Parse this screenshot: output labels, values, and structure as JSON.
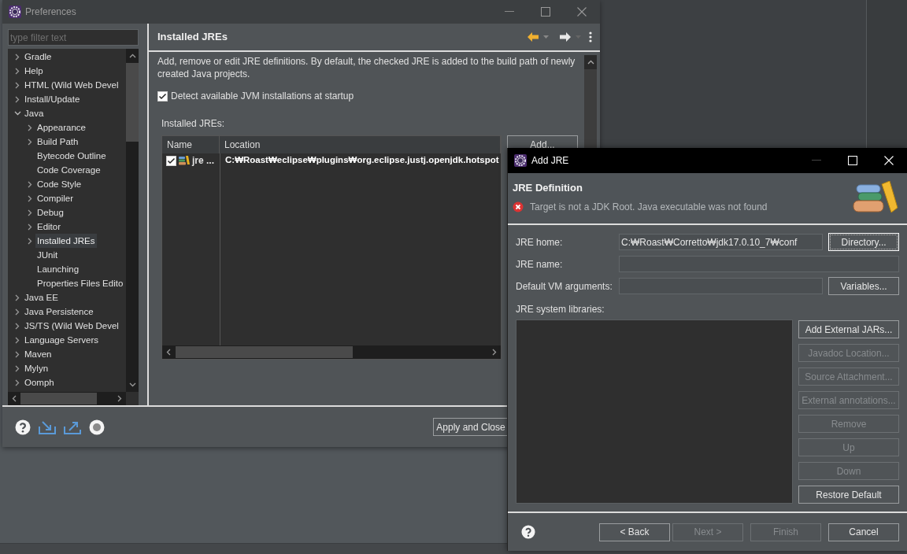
{
  "preferences": {
    "title": "Preferences",
    "filter": {
      "placeholder": "type filter text"
    },
    "tree": [
      {
        "label": "Gradle",
        "expandable": true,
        "expanded": false,
        "selected": false
      },
      {
        "label": "Help",
        "expandable": true,
        "expanded": false,
        "selected": false
      },
      {
        "label": "HTML (Wild Web Devel",
        "expandable": true,
        "expanded": false,
        "selected": false
      },
      {
        "label": "Install/Update",
        "expandable": true,
        "expanded": false,
        "selected": false
      },
      {
        "label": "Java",
        "expandable": true,
        "expanded": true,
        "selected": false,
        "children": [
          {
            "label": "Appearance",
            "expandable": true,
            "expanded": false,
            "selected": false
          },
          {
            "label": "Build Path",
            "expandable": true,
            "expanded": false,
            "selected": false
          },
          {
            "label": "Bytecode Outline",
            "expandable": false,
            "expanded": false,
            "selected": false
          },
          {
            "label": "Code Coverage",
            "expandable": false,
            "expanded": false,
            "selected": false
          },
          {
            "label": "Code Style",
            "expandable": true,
            "expanded": false,
            "selected": false
          },
          {
            "label": "Compiler",
            "expandable": true,
            "expanded": false,
            "selected": false
          },
          {
            "label": "Debug",
            "expandable": true,
            "expanded": false,
            "selected": false
          },
          {
            "label": "Editor",
            "expandable": true,
            "expanded": false,
            "selected": false
          },
          {
            "label": "Installed JREs",
            "expandable": true,
            "expanded": false,
            "selected": true
          },
          {
            "label": "JUnit",
            "expandable": false,
            "expanded": false,
            "selected": false
          },
          {
            "label": "Launching",
            "expandable": false,
            "expanded": false,
            "selected": false
          },
          {
            "label": "Properties Files Edito",
            "expandable": false,
            "expanded": false,
            "selected": false
          }
        ]
      },
      {
        "label": "Java EE",
        "expandable": true,
        "expanded": false,
        "selected": false
      },
      {
        "label": "Java Persistence",
        "expandable": true,
        "expanded": false,
        "selected": false
      },
      {
        "label": "JS/TS (Wild Web Devel",
        "expandable": true,
        "expanded": false,
        "selected": false
      },
      {
        "label": "Language Servers",
        "expandable": true,
        "expanded": false,
        "selected": false
      },
      {
        "label": "Maven",
        "expandable": true,
        "expanded": false,
        "selected": false
      },
      {
        "label": "Mylyn",
        "expandable": true,
        "expanded": false,
        "selected": false
      },
      {
        "label": "Oomph",
        "expandable": true,
        "expanded": false,
        "selected": false
      }
    ],
    "page": {
      "title": "Installed JREs",
      "description": "Add, remove or edit JRE definitions. By default, the checked JRE is added to the build path of newly created Java projects.",
      "detect": {
        "label": "Detect available JVM installations at startup",
        "checked": true
      },
      "list_label": "Installed JREs:",
      "table": {
        "columns": [
          "Name",
          "Location"
        ],
        "rows": [
          {
            "checked": true,
            "default": true,
            "name": "jre ...",
            "location": "C:₩Roast₩eclipse₩plugins₩org.eclipse.justj.openjdk.hotspot"
          }
        ]
      },
      "buttons": [
        "Add..."
      ]
    },
    "footer_buttons": [
      "Apply and Close"
    ]
  },
  "add_jre": {
    "title": "Add JRE",
    "heading": "JRE Definition",
    "message": {
      "kind": "error",
      "text": "Target is not a JDK Root. Java executable was not found"
    },
    "fields": [
      {
        "label": "JRE home:",
        "value": "C:₩Roast₩Corretto₩jdk17.0.10_7₩conf",
        "button": {
          "label": "Directory...",
          "focused": true
        }
      },
      {
        "label": "JRE name:"
      },
      {
        "label": "Default VM arguments:",
        "button": {
          "label": "Variables...",
          "focused": false
        }
      }
    ],
    "libraries_label": "JRE system libraries:",
    "library_buttons": [
      {
        "label": "Add External JARs...",
        "disabled": false
      },
      {
        "label": "Javadoc Location...",
        "disabled": true
      },
      {
        "label": "Source Attachment...",
        "disabled": true
      },
      {
        "label": "External annotations...",
        "disabled": true
      },
      {
        "label": "Remove",
        "disabled": true
      },
      {
        "label": "Up",
        "disabled": true
      },
      {
        "label": "Down",
        "disabled": true
      },
      {
        "label": "Restore Default",
        "disabled": false
      }
    ],
    "nav_buttons": [
      {
        "label": "< Back",
        "disabled": false
      },
      {
        "label": "Next >",
        "disabled": true
      },
      {
        "label": "Finish",
        "disabled": true
      },
      {
        "label": "Cancel",
        "disabled": false
      }
    ]
  }
}
